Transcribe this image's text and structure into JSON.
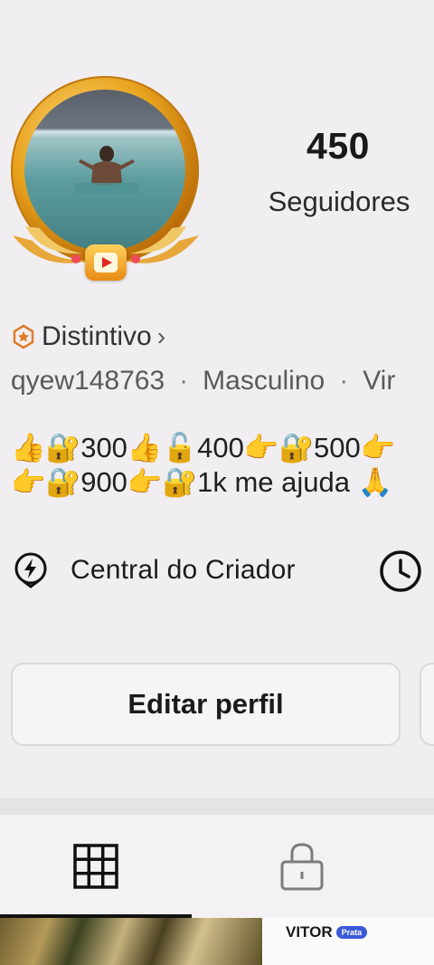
{
  "profile": {
    "followers_count": "450",
    "followers_label": "Seguidores",
    "badge_label": "Distintivo",
    "badge_chevron": "›",
    "username": "qyew148763",
    "gender": "Masculino",
    "extra_meta": "Vir",
    "meta_separator": "·",
    "bio_line_1": "👍🔐300👍🔓400👉🔐500👉",
    "bio_line_2": "👉🔐900👉🔐1k me ajuda 🙏"
  },
  "creator": {
    "label": "Central do Criador"
  },
  "actions": {
    "edit_profile_label": "Editar perfil"
  },
  "thumbnails": {
    "second_text": "VITOR",
    "second_badge": "Prata"
  },
  "colors": {
    "background": "#f1eef1",
    "gold": "#e8a21c",
    "badge_orange": "#e07b28",
    "tab_indicator": "#111111"
  },
  "icons": {
    "badge": "hexagon-badge-icon",
    "creator": "lightning-bulb-icon",
    "history": "clock-icon",
    "grid": "grid-icon",
    "lock": "lock-icon",
    "video": "video-play-icon"
  }
}
